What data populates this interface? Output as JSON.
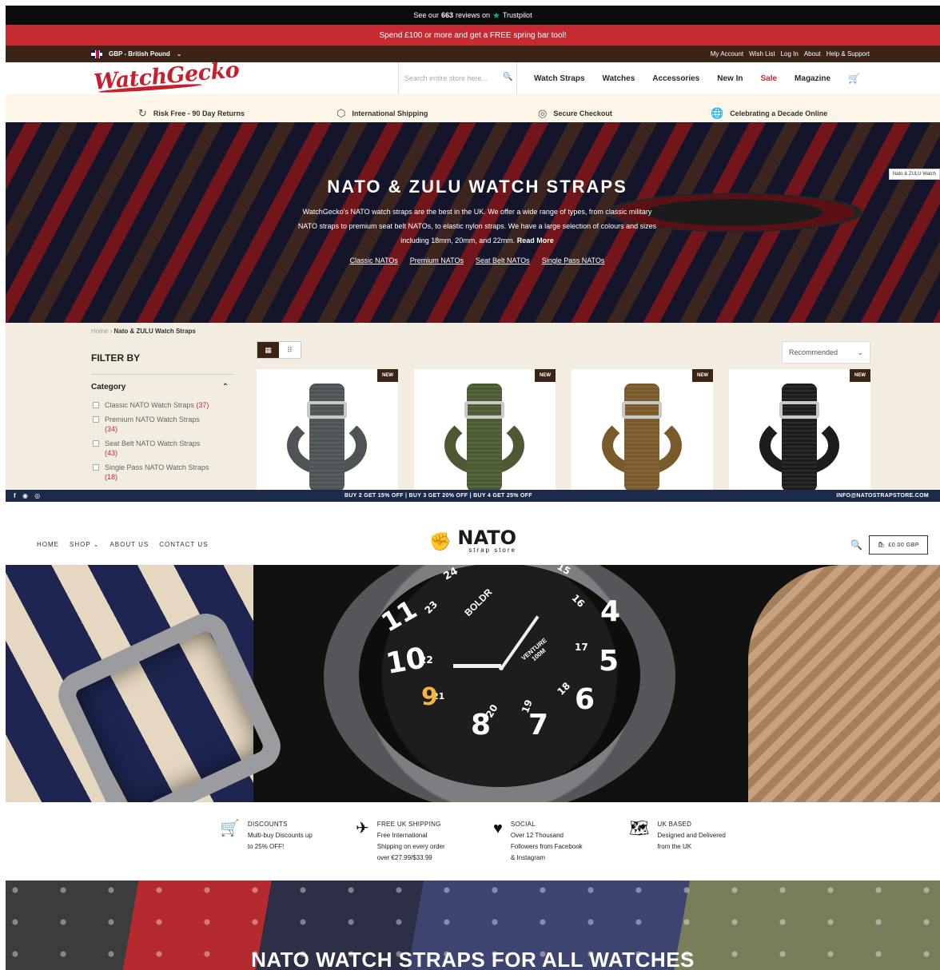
{
  "site1": {
    "trustpilot": {
      "prefix": "See our",
      "count": "663",
      "suffix": "reviews on",
      "brand": "Trustpilot",
      "star": "★"
    },
    "promo": "Spend £100 or more and get a FREE spring bar tool!",
    "currency": "GBP - British Pound",
    "currency_caret": "⌄",
    "util_links": [
      "My Account",
      "Wish List",
      "Log In",
      "About",
      "Help & Support"
    ],
    "logo": "WatchGecko",
    "search_placeholder": "Search entire store here...",
    "search_icon": "🔍",
    "menu": [
      "Watch Straps",
      "Watches",
      "Accessories",
      "New In",
      "Sale",
      "Magazine"
    ],
    "cart_icon": "🛒",
    "trust": [
      {
        "icon": "↻",
        "icon_name": "returns-icon",
        "label": "Risk Free - 90 Day Returns"
      },
      {
        "icon": "⬡",
        "icon_name": "package-icon",
        "label": "International Shipping"
      },
      {
        "icon": "◎",
        "icon_name": "lock-icon",
        "label": "Secure Checkout"
      },
      {
        "icon": "🌐",
        "icon_name": "globe-icon",
        "label": "Celebrating a Decade Online"
      }
    ],
    "hero": {
      "title": "NATO & ZULU WATCH STRAPS",
      "body": "WatchGecko's NATO watch straps are the best in the UK. We offer a wide range of types, from classic military NATO straps to premium seat belt NATOs, to elastic nylon straps. We have a large selection of colours and sizes including 18mm, 20mm, and 22mm.",
      "read_more": "Read More",
      "links": [
        "Classic NATOs",
        "Premium NATOs",
        "Seat Belt NATOs",
        "Single Pass NATOs"
      ],
      "tooltip": "Nato & ZULU Watch"
    },
    "breadcrumb": {
      "home": "Home",
      "sep": "›",
      "current": "Nato & ZULU Watch Straps"
    },
    "filter_title": "FILTER BY",
    "category": {
      "title": "Category",
      "caret": "⌃",
      "items": [
        {
          "label": "Classic NATO Watch Straps",
          "count": "(37)"
        },
        {
          "label": "Premium NATO Watch Straps",
          "count": "(34)"
        },
        {
          "label": "Seat Belt NATO Watch Straps",
          "count": "(43)"
        },
        {
          "label": "Single Pass NATO Watch Straps",
          "count": "(18)"
        }
      ]
    },
    "view_icons": {
      "list": "▦",
      "grid": "⠿"
    },
    "sort": {
      "value": "Recommended",
      "caret": "⌄"
    },
    "products": [
      {
        "badge": "NEW",
        "color": "#4e5356"
      },
      {
        "badge": "NEW",
        "color": "#4b5a33"
      },
      {
        "badge": "NEW",
        "color": "#7a5a2a"
      },
      {
        "badge": "NEW",
        "color": "#1c1c1c"
      }
    ]
  },
  "site2": {
    "social_icons": [
      "f",
      "◉",
      "◎"
    ],
    "offer": "BUY 2 GET 15% OFF | BUY 3 GET 20% OFF | BUY 4 GET 25% OFF",
    "email": "INFO@NATOSTRAPSTORE.COM",
    "menu": [
      "HOME",
      "SHOP ⌄",
      "ABOUT US",
      "CONTACT US"
    ],
    "logo": {
      "mark": "✊",
      "title": "NATO",
      "sub": "strap store"
    },
    "search_icon": "🔍",
    "cart": {
      "icon": "🛍",
      "label": "£0.00 GBP"
    },
    "watch": {
      "brand": "BOLDR",
      "model": "VENTURE",
      "depth": "100M",
      "numbers": [
        "24",
        "15",
        "23",
        "16",
        "22",
        "17",
        "21",
        "18",
        "20",
        "19",
        "11",
        "4",
        "10",
        "5",
        "9",
        "6",
        "8",
        "7"
      ]
    },
    "features": [
      {
        "icon": "🛒",
        "icon_name": "cart-icon",
        "title": "DISCOUNTS",
        "lines": [
          "Multi-buy Discounts up",
          "to 25% OFF!"
        ]
      },
      {
        "icon": "✈",
        "icon_name": "plane-icon",
        "title": "FREE UK SHIPPING",
        "lines": [
          "Free International",
          "Shipping on every order",
          "over €27.99/$33.99"
        ]
      },
      {
        "icon": "♥",
        "icon_name": "heart-icon",
        "title": "SOCIAL",
        "lines": [
          "Over 12 Thousand",
          "Followers from Facebook",
          "& Instagram"
        ]
      },
      {
        "icon": "🗺",
        "icon_name": "map-icon",
        "title": "UK BASED",
        "lines": [
          "Designed and Delivered",
          "from the UK"
        ]
      }
    ],
    "banner_title": "NATO WATCH STRAPS FOR ALL WATCHES"
  }
}
